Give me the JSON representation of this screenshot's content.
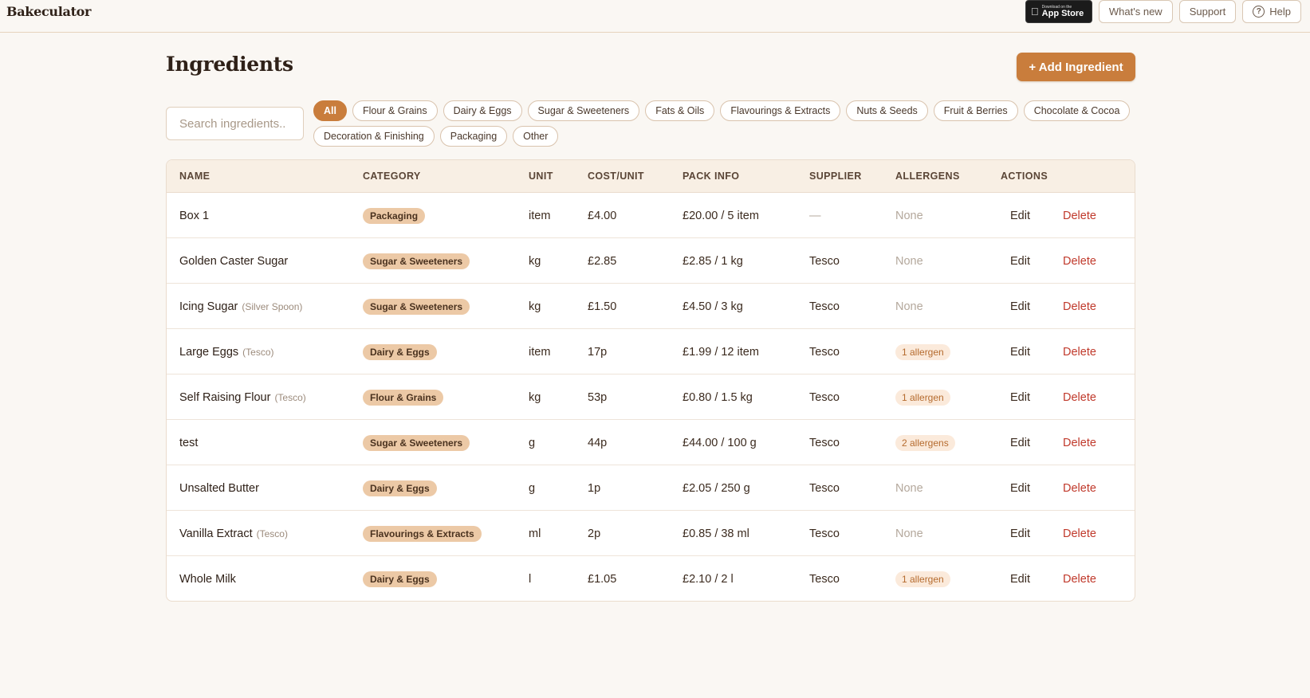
{
  "app": {
    "brand": "Bakeculator"
  },
  "nav": {
    "appstore_small": "Download on the",
    "appstore_big": "App Store",
    "whats_new": "What's new",
    "support": "Support",
    "help": "Help"
  },
  "page": {
    "title": "Ingredients",
    "add_button": "+ Add Ingredient",
    "search_placeholder": "Search ingredients..",
    "search_value": ""
  },
  "filters": {
    "row1": [
      "All",
      "Flour & Grains",
      "Dairy & Eggs",
      "Sugar & Sweeteners",
      "Fats & Oils",
      "Flavourings & Extracts",
      "Nuts & Seeds",
      "Fruit & Berries",
      "Chocolate & Cocoa"
    ],
    "row2": [
      "Decoration & Finishing",
      "Packaging",
      "Other"
    ],
    "active": "All"
  },
  "table": {
    "headers": [
      "NAME",
      "CATEGORY",
      "UNIT",
      "COST/UNIT",
      "PACK INFO",
      "SUPPLIER",
      "ALLERGENS",
      "ACTIONS"
    ],
    "edit_label": "Edit",
    "delete_label": "Delete",
    "rows": [
      {
        "name": "Box 1",
        "sub": "",
        "category": "Packaging",
        "unit": "item",
        "cost": "£4.00",
        "pack": "£20.00 / 5 item",
        "supplier": "—",
        "allergens": "None"
      },
      {
        "name": "Golden Caster Sugar",
        "sub": "",
        "category": "Sugar & Sweeteners",
        "unit": "kg",
        "cost": "£2.85",
        "pack": "£2.85 / 1 kg",
        "supplier": "Tesco",
        "allergens": "None"
      },
      {
        "name": "Icing Sugar",
        "sub": "(Silver Spoon)",
        "category": "Sugar & Sweeteners",
        "unit": "kg",
        "cost": "£1.50",
        "pack": "£4.50 / 3 kg",
        "supplier": "Tesco",
        "allergens": "None"
      },
      {
        "name": "Large Eggs",
        "sub": "(Tesco)",
        "category": "Dairy & Eggs",
        "unit": "item",
        "cost": "17p",
        "pack": "£1.99 / 12 item",
        "supplier": "Tesco",
        "allergens": "1 allergen"
      },
      {
        "name": "Self Raising Flour",
        "sub": "(Tesco)",
        "category": "Flour & Grains",
        "unit": "kg",
        "cost": "53p",
        "pack": "£0.80 / 1.5 kg",
        "supplier": "Tesco",
        "allergens": "1 allergen"
      },
      {
        "name": "test",
        "sub": "",
        "category": "Sugar & Sweeteners",
        "unit": "g",
        "cost": "44p",
        "pack": "£44.00 / 100 g",
        "supplier": "Tesco",
        "allergens": "2 allergens"
      },
      {
        "name": "Unsalted Butter",
        "sub": "",
        "category": "Dairy & Eggs",
        "unit": "g",
        "cost": "1p",
        "pack": "£2.05 / 250 g",
        "supplier": "Tesco",
        "allergens": "None"
      },
      {
        "name": "Vanilla Extract",
        "sub": "(Tesco)",
        "category": "Flavourings & Extracts",
        "unit": "ml",
        "cost": "2p",
        "pack": "£0.85 / 38 ml",
        "supplier": "Tesco",
        "allergens": "None"
      },
      {
        "name": "Whole Milk",
        "sub": "",
        "category": "Dairy & Eggs",
        "unit": "l",
        "cost": "£1.05",
        "pack": "£2.10 / 2 l",
        "supplier": "Tesco",
        "allergens": "1 allergen"
      }
    ]
  },
  "colors": {
    "accent": "#c97d3c",
    "background": "#faf7f3",
    "delete": "#c0392b",
    "category_badge": "#ecc9a6",
    "allergen_badge": "#fbeadb"
  }
}
